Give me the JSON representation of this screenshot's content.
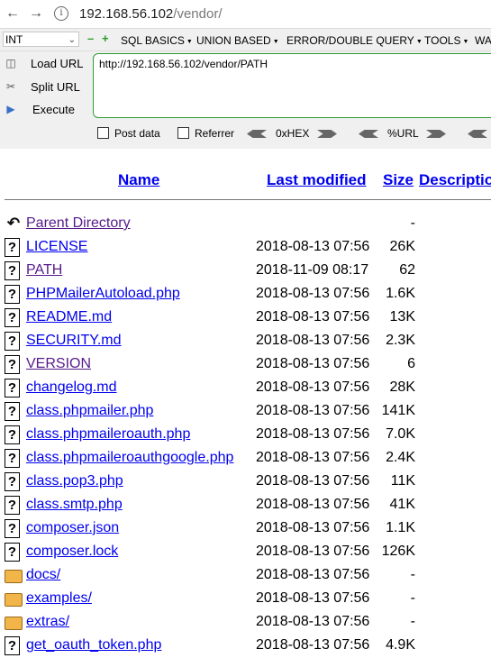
{
  "browser": {
    "url_host": "192.168.56.102",
    "url_path": "/vendor/"
  },
  "hackbar": {
    "select_value": "INT",
    "menus": [
      "SQL BASICS",
      "UNION BASED",
      "ERROR/DOUBLE QUERY",
      "TOOLS",
      "WA"
    ],
    "actions": {
      "load": "Load URL",
      "split": "Split URL",
      "execute": "Execute"
    },
    "url_value": "http://192.168.56.102/vendor/PATH",
    "post_data": "Post data",
    "referrer": "Referrer",
    "hex": "0xHEX",
    "url_enc": "%URL"
  },
  "listing": {
    "headers": {
      "name": "Name",
      "modified": "Last modified",
      "size": "Size",
      "desc": "Description"
    },
    "rows": [
      {
        "name": "Parent Directory",
        "date": "",
        "size": "-",
        "icon": "parent-dir-icon",
        "visited": true
      },
      {
        "name": "LICENSE",
        "date": "2018-08-13 07:56",
        "size": "26K",
        "icon": "file-unknown-icon",
        "visited": false
      },
      {
        "name": "PATH",
        "date": "2018-11-09 08:17",
        "size": "62",
        "icon": "file-unknown-icon",
        "visited": true
      },
      {
        "name": "PHPMailerAutoload.php",
        "date": "2018-08-13 07:56",
        "size": "1.6K",
        "icon": "file-unknown-icon",
        "visited": false
      },
      {
        "name": "README.md",
        "date": "2018-08-13 07:56",
        "size": "13K",
        "icon": "file-unknown-icon",
        "visited": false
      },
      {
        "name": "SECURITY.md",
        "date": "2018-08-13 07:56",
        "size": "2.3K",
        "icon": "file-unknown-icon",
        "visited": false
      },
      {
        "name": "VERSION",
        "date": "2018-08-13 07:56",
        "size": "6",
        "icon": "file-unknown-icon",
        "visited": true
      },
      {
        "name": "changelog.md",
        "date": "2018-08-13 07:56",
        "size": "28K",
        "icon": "file-unknown-icon",
        "visited": false
      },
      {
        "name": "class.phpmailer.php",
        "date": "2018-08-13 07:56",
        "size": "141K",
        "icon": "file-unknown-icon",
        "visited": false
      },
      {
        "name": "class.phpmaileroauth.php",
        "date": "2018-08-13 07:56",
        "size": "7.0K",
        "icon": "file-unknown-icon",
        "visited": false
      },
      {
        "name": "class.phpmaileroauthgoogle.php",
        "date": "2018-08-13 07:56",
        "size": "2.4K",
        "icon": "file-unknown-icon",
        "visited": false
      },
      {
        "name": "class.pop3.php",
        "date": "2018-08-13 07:56",
        "size": "11K",
        "icon": "file-unknown-icon",
        "visited": false
      },
      {
        "name": "class.smtp.php",
        "date": "2018-08-13 07:56",
        "size": "41K",
        "icon": "file-unknown-icon",
        "visited": false
      },
      {
        "name": "composer.json",
        "date": "2018-08-13 07:56",
        "size": "1.1K",
        "icon": "file-unknown-icon",
        "visited": false
      },
      {
        "name": "composer.lock",
        "date": "2018-08-13 07:56",
        "size": "126K",
        "icon": "file-unknown-icon",
        "visited": false
      },
      {
        "name": "docs/",
        "date": "2018-08-13 07:56",
        "size": "-",
        "icon": "folder-icon",
        "visited": false
      },
      {
        "name": "examples/",
        "date": "2018-08-13 07:56",
        "size": "-",
        "icon": "folder-icon",
        "visited": false
      },
      {
        "name": "extras/",
        "date": "2018-08-13 07:56",
        "size": "-",
        "icon": "folder-icon",
        "visited": false
      },
      {
        "name": "get_oauth_token.php",
        "date": "2018-08-13 07:56",
        "size": "4.9K",
        "icon": "file-unknown-icon",
        "visited": false
      }
    ]
  }
}
